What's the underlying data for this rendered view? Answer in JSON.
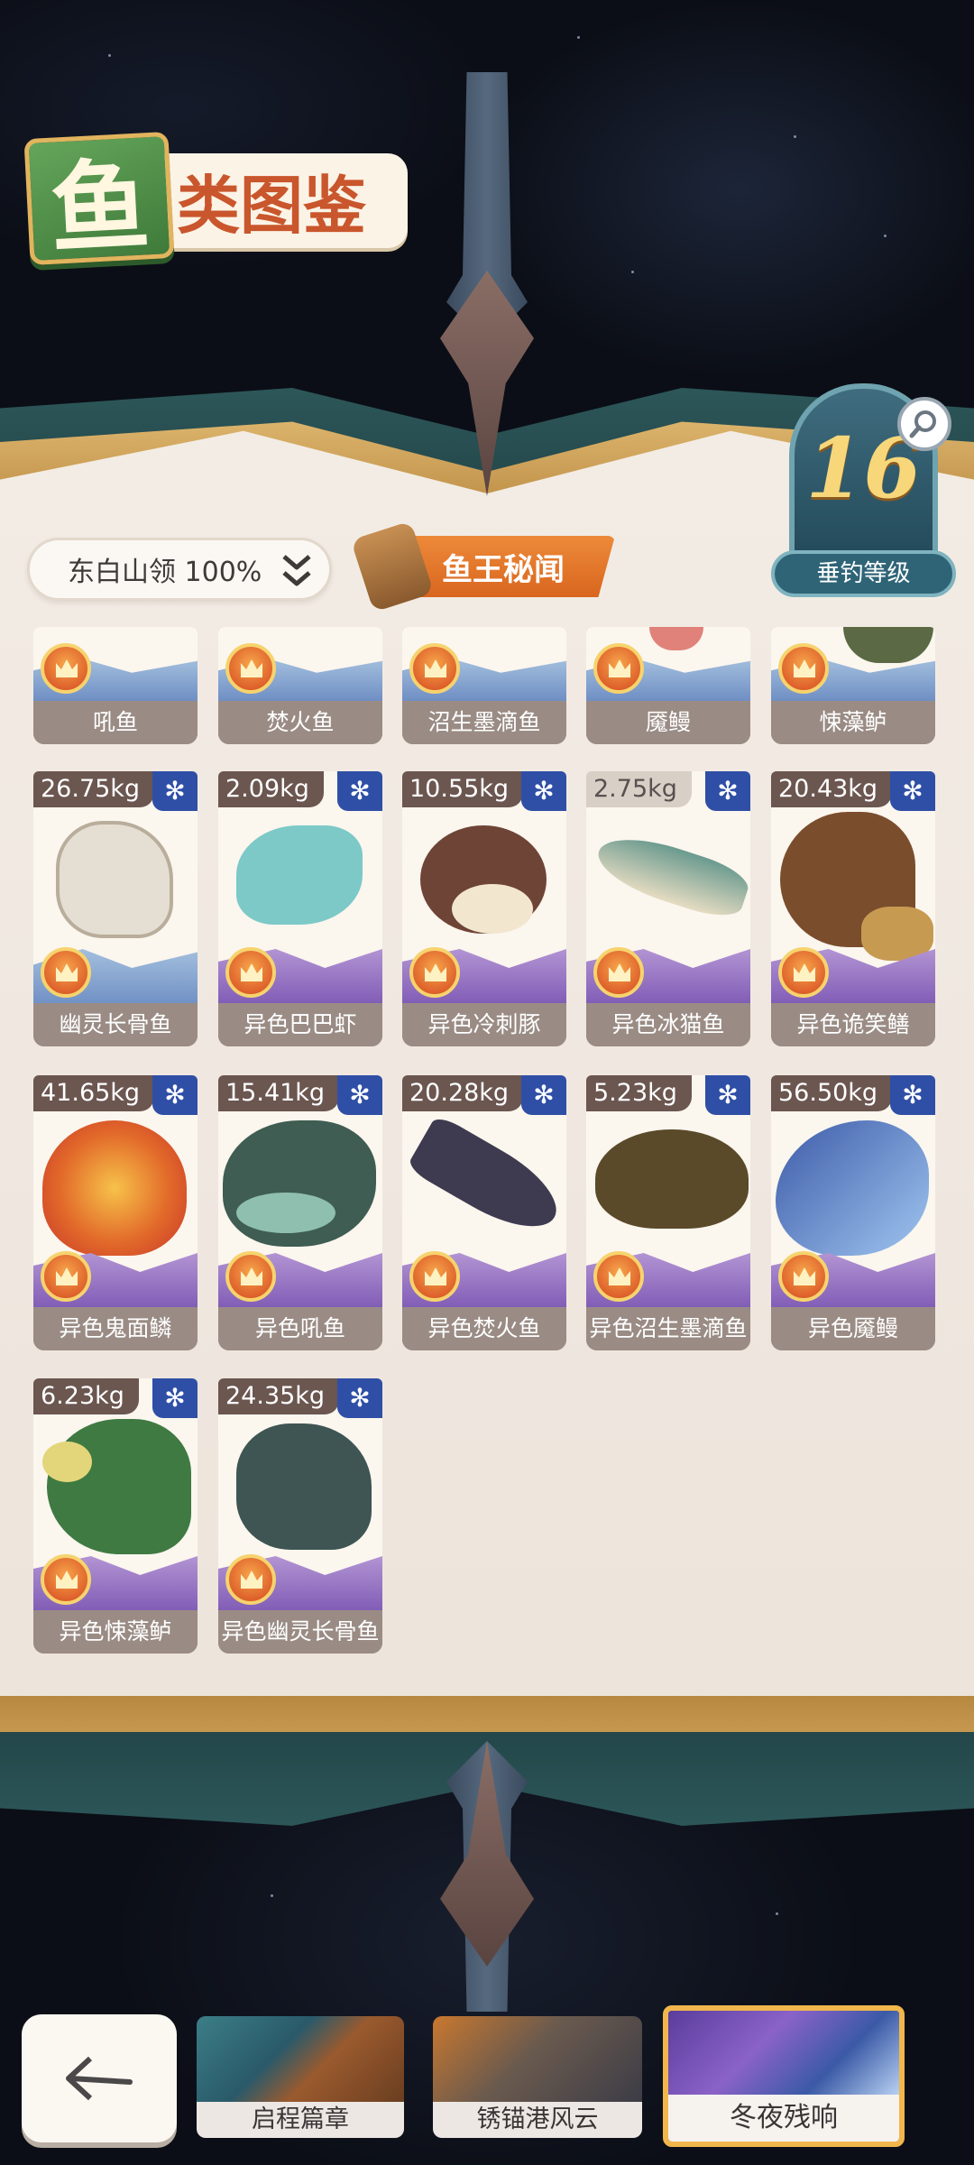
{
  "header": {
    "title_char1": "鱼",
    "title_rest": "类图鉴"
  },
  "level": {
    "value": "16",
    "label": "垂钓等级"
  },
  "region": {
    "label": "东白山领 100%"
  },
  "legend_button": {
    "label": "鱼王秘闻"
  },
  "fish_row_partial": [
    {
      "name": "吼鱼"
    },
    {
      "name": "焚火鱼"
    },
    {
      "name": "沼生墨滴鱼"
    },
    {
      "name": "魇鳗"
    },
    {
      "name": "悚藻鲈"
    }
  ],
  "fish_row2": [
    {
      "name": "幽灵长骨鱼",
      "weight": "26.75kg"
    },
    {
      "name": "异色巴巴虾",
      "weight": "2.09kg"
    },
    {
      "name": "异色冷刺豚",
      "weight": "10.55kg"
    },
    {
      "name": "异色冰猫鱼",
      "weight": "2.75kg"
    },
    {
      "name": "异色诡笑鳝",
      "weight": "20.43kg"
    }
  ],
  "fish_row3": [
    {
      "name": "异色鬼面鳞",
      "weight": "41.65kg"
    },
    {
      "name": "异色吼鱼",
      "weight": "15.41kg"
    },
    {
      "name": "异色焚火鱼",
      "weight": "20.28kg"
    },
    {
      "name": "异色沼生墨滴鱼",
      "weight": "5.23kg"
    },
    {
      "name": "异色魇鳗",
      "weight": "56.50kg"
    }
  ],
  "fish_row4": [
    {
      "name": "异色悚藻鲈",
      "weight": "6.23kg"
    },
    {
      "name": "异色幽灵长骨鱼",
      "weight": "24.35kg"
    }
  ],
  "chapters": [
    {
      "label": "启程篇章"
    },
    {
      "label": "锈锚港风云"
    },
    {
      "label": "冬夜残响"
    }
  ],
  "icons": {
    "back": "back-arrow-icon",
    "zoom": "magnify-icon",
    "rarity": "star-icon",
    "crown": "crown-icon"
  },
  "colors": {
    "accent_orange": "#e27a2e",
    "level_teal": "#2f6477",
    "rare_blue": "#2f4fa6"
  }
}
